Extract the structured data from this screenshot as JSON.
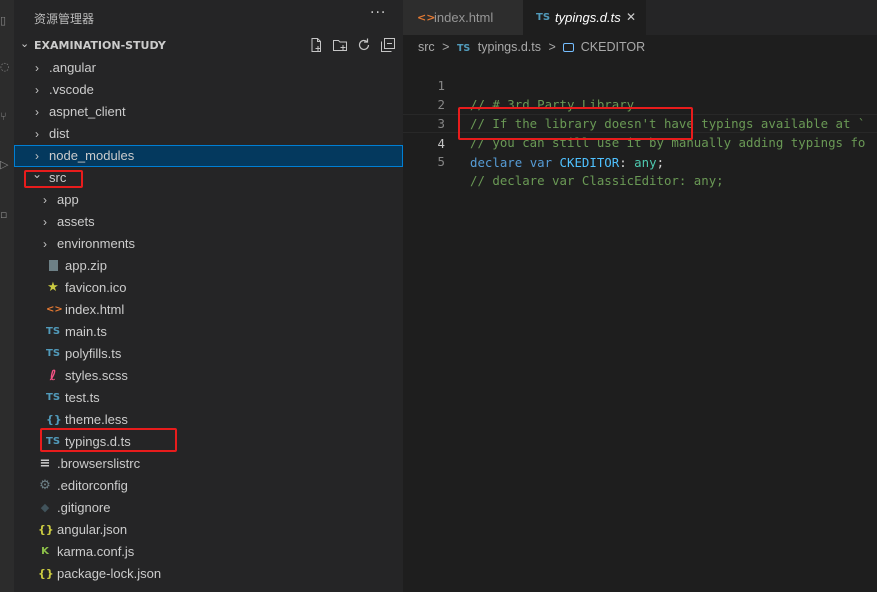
{
  "sidebar": {
    "title": "资源管理器",
    "more": "···",
    "project": "EXAMINATION-STUDY",
    "items": [
      {
        "label": ".angular",
        "kind": "folder",
        "expanded": false,
        "depth": 0
      },
      {
        "label": ".vscode",
        "kind": "folder",
        "expanded": false,
        "depth": 0
      },
      {
        "label": "aspnet_client",
        "kind": "folder",
        "expanded": false,
        "depth": 0
      },
      {
        "label": "dist",
        "kind": "folder",
        "expanded": false,
        "depth": 0
      },
      {
        "label": "node_modules",
        "kind": "folder",
        "expanded": false,
        "depth": 0,
        "selected": true
      },
      {
        "label": "src",
        "kind": "folder",
        "expanded": true,
        "depth": 0
      },
      {
        "label": "app",
        "kind": "folder",
        "expanded": false,
        "depth": 1
      },
      {
        "label": "assets",
        "kind": "folder",
        "expanded": false,
        "depth": 1
      },
      {
        "label": "environments",
        "kind": "folder",
        "expanded": false,
        "depth": 1
      },
      {
        "label": "app.zip",
        "kind": "zip",
        "depth": 1
      },
      {
        "label": "favicon.ico",
        "kind": "star",
        "depth": 1
      },
      {
        "label": "index.html",
        "kind": "html",
        "depth": 1
      },
      {
        "label": "main.ts",
        "kind": "ts",
        "depth": 1
      },
      {
        "label": "polyfills.ts",
        "kind": "ts",
        "depth": 1
      },
      {
        "label": "styles.scss",
        "kind": "scss",
        "depth": 1
      },
      {
        "label": "test.ts",
        "kind": "ts",
        "depth": 1
      },
      {
        "label": "theme.less",
        "kind": "less",
        "depth": 1
      },
      {
        "label": "typings.d.ts",
        "kind": "ts",
        "depth": 1
      },
      {
        "label": ".browserslistrc",
        "kind": "lines",
        "depth": 0
      },
      {
        "label": ".editorconfig",
        "kind": "gear",
        "depth": 0
      },
      {
        "label": ".gitignore",
        "kind": "git",
        "depth": 0
      },
      {
        "label": "angular.json",
        "kind": "json",
        "depth": 0
      },
      {
        "label": "karma.conf.js",
        "kind": "karma",
        "depth": 0
      },
      {
        "label": "package-lock.json",
        "kind": "json",
        "depth": 0
      }
    ]
  },
  "icons": {
    "ts": "TS",
    "html": "<>",
    "json": "{}",
    "less": "{}",
    "karma": "K",
    "star": "★",
    "folder_closed": "›",
    "folder_open": "⌄"
  },
  "colors": {
    "ts": "#519aba",
    "html": "#e37933",
    "json": "#cbcb41",
    "less": "#519aba",
    "scss": "#f55385",
    "star": "#cbcb41",
    "karma": "#8dc149",
    "gear": "#6d8086",
    "git": "#41535b",
    "zip": "#6d8086",
    "highlight": "#e81c1c"
  },
  "tabs": [
    {
      "label": "index.html",
      "icon": "html",
      "active": false
    },
    {
      "label": "typings.d.ts",
      "icon": "ts",
      "active": true,
      "close": "✕"
    }
  ],
  "breadcrumb": {
    "folder": "src",
    "sep": ">",
    "file_icon": "TS",
    "file": "typings.d.ts",
    "symbol": "CKEDITOR"
  },
  "code": {
    "lines": [
      {
        "no": "1",
        "text": "// # 3rd Party Library"
      },
      {
        "no": "2",
        "text": "// If the library doesn't have typings available at `"
      },
      {
        "no": "3",
        "text": "// you can still use it by manually adding typings fo"
      },
      {
        "no": "4",
        "tokens": [
          "declare",
          "var",
          "CKEDITOR",
          ":",
          "any",
          ";"
        ]
      },
      {
        "no": "5",
        "text": "// declare var ClassicEditor: any;"
      }
    ]
  }
}
